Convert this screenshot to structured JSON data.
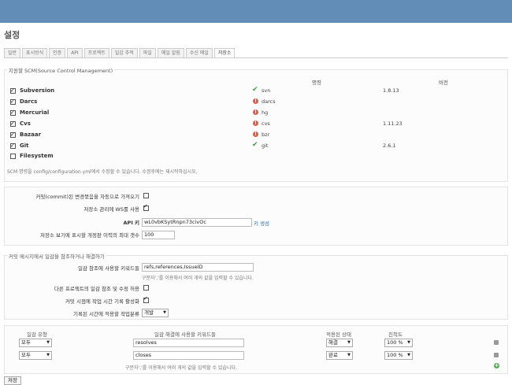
{
  "page_title": "설정",
  "tabs": [
    "일반",
    "표시방식",
    "인증",
    "API",
    "프로젝트",
    "일감 추적",
    "파일",
    "메일 알림",
    "수신 메일",
    "저장소"
  ],
  "scm": {
    "legend": "지원할 SCM(Source Control Management)",
    "col_command": "명령",
    "col_version": "버전",
    "items": [
      {
        "name": "Subversion",
        "checked": true,
        "status": "ok",
        "command": "svn",
        "version": "1.8.13"
      },
      {
        "name": "Darcs",
        "checked": true,
        "status": "error",
        "command": "darcs",
        "version": ""
      },
      {
        "name": "Mercurial",
        "checked": true,
        "status": "error",
        "command": "hg",
        "version": ""
      },
      {
        "name": "Cvs",
        "checked": true,
        "status": "error",
        "command": "cvs",
        "version": "1.11.23"
      },
      {
        "name": "Bazaar",
        "checked": true,
        "status": "error",
        "command": "bzr",
        "version": ""
      },
      {
        "name": "Git",
        "checked": true,
        "status": "ok",
        "command": "git",
        "version": "2.6.1"
      },
      {
        "name": "Filesystem",
        "checked": false,
        "status": "",
        "command": "",
        "version": ""
      }
    ],
    "note": "SCM 명령을 config/configuration.yml에서 수정할 수 있습니다. 수정후에는 재시작하십시오."
  },
  "repo": {
    "autofetch_label": "커밋(commit)된 변경묶음을 자동으로 가져오기",
    "autofetch_checked": false,
    "ws_label": "저장소 관리에 WS를 사용",
    "ws_checked": true,
    "apikey_label": "API 키",
    "apikey_value": "wL0vbKSytRnpn73civOc",
    "generate_link": "키 생성",
    "maxrev_label": "저장소 보기에 표시할 개정판 이력의 최대 갯수",
    "maxrev_value": "100"
  },
  "commit": {
    "legend": "커밋 메시지에서 일감을 참조하거나 해결하기",
    "ref_label": "일감 참조에 사용할 키워드들",
    "ref_value": "refs,references,IssueID",
    "ref_note": "구분자','를 이용해서 여러 개의 값을 입력할 수 있습니다.",
    "cross_label": "다른 프로젝트의 일감 참조 및 수정 허용",
    "cross_checked": false,
    "timelog_label": "커밋 시점에 작업 시간 기록 활성화",
    "timelog_checked": true,
    "activity_label": "기록된 시간에 적용할 작업분류",
    "activity_value": "개발"
  },
  "fix": {
    "headers": [
      "일감 유형",
      "일감 해결에 사용할 키워드들",
      "적용된 상태",
      "진척도"
    ],
    "rows": [
      {
        "tracker": "모두",
        "keywords": "resolves",
        "status": "해결",
        "ratio": "100 %"
      },
      {
        "tracker": "모두",
        "keywords": "closes",
        "status": "완료",
        "ratio": "100 %"
      }
    ],
    "note": "구분자','를 이용해서 여러 개의 값을 입력할 수 있습니다."
  },
  "save_label": "저장"
}
